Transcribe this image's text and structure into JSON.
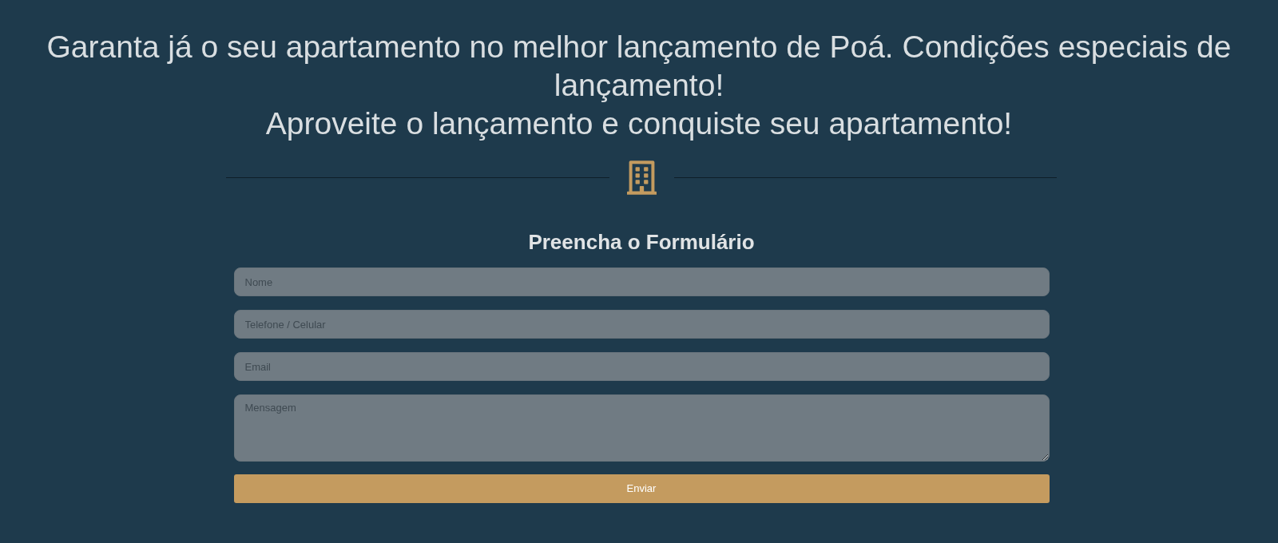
{
  "headline": {
    "lines": [
      "Garanta já o seu apartamento no melhor lançamento de Poá. Condições especiais de lançamento!",
      "Aproveite o lançamento e conquiste seu apartamento!"
    ]
  },
  "form": {
    "title": "Preencha o Formulário",
    "fields": [
      {
        "kind": "input",
        "placeholder": "Nome"
      },
      {
        "kind": "input",
        "placeholder": "Telefone / Celular"
      },
      {
        "kind": "input",
        "placeholder": "Email"
      },
      {
        "kind": "textarea",
        "placeholder": "Mensagem"
      }
    ],
    "submit": "Enviar"
  }
}
